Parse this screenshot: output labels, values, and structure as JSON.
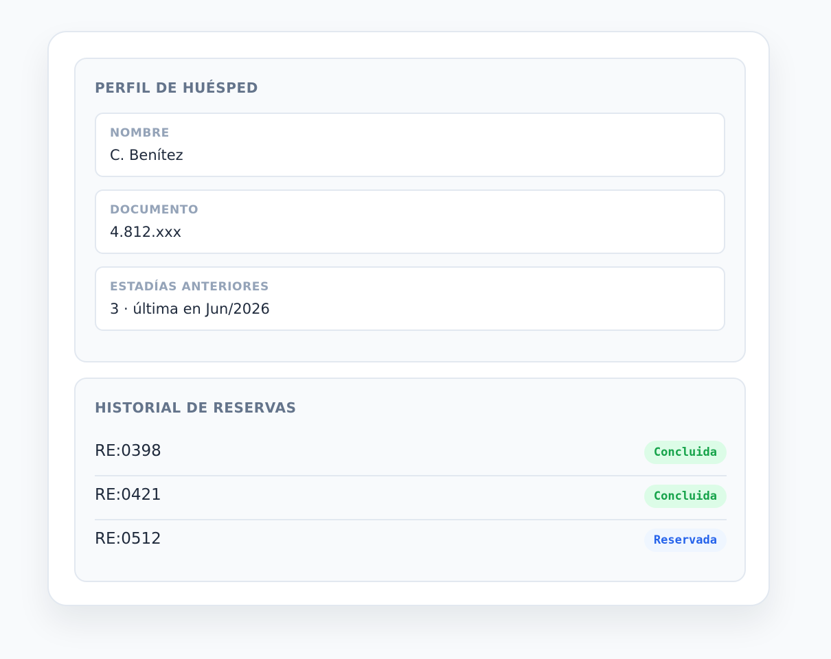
{
  "profile": {
    "title": "PERFIL DE HUÉSPED",
    "fields": [
      {
        "label": "NOMBRE",
        "value": "C. Benítez"
      },
      {
        "label": "DOCUMENTO",
        "value": "4.812.xxx"
      },
      {
        "label": "ESTADÍAS ANTERIORES",
        "value": "3 · última en Jun/2026"
      }
    ]
  },
  "history": {
    "title": "HISTORIAL DE RESERVAS",
    "bookings": [
      {
        "id": "RE:0398",
        "status": "Concluida",
        "status_color": "#16a34a"
      },
      {
        "id": "RE:0421",
        "status": "Concluida",
        "status_color": "#16a34a"
      },
      {
        "id": "RE:0512",
        "status": "Reservada",
        "status_color": "#2563eb"
      }
    ]
  }
}
